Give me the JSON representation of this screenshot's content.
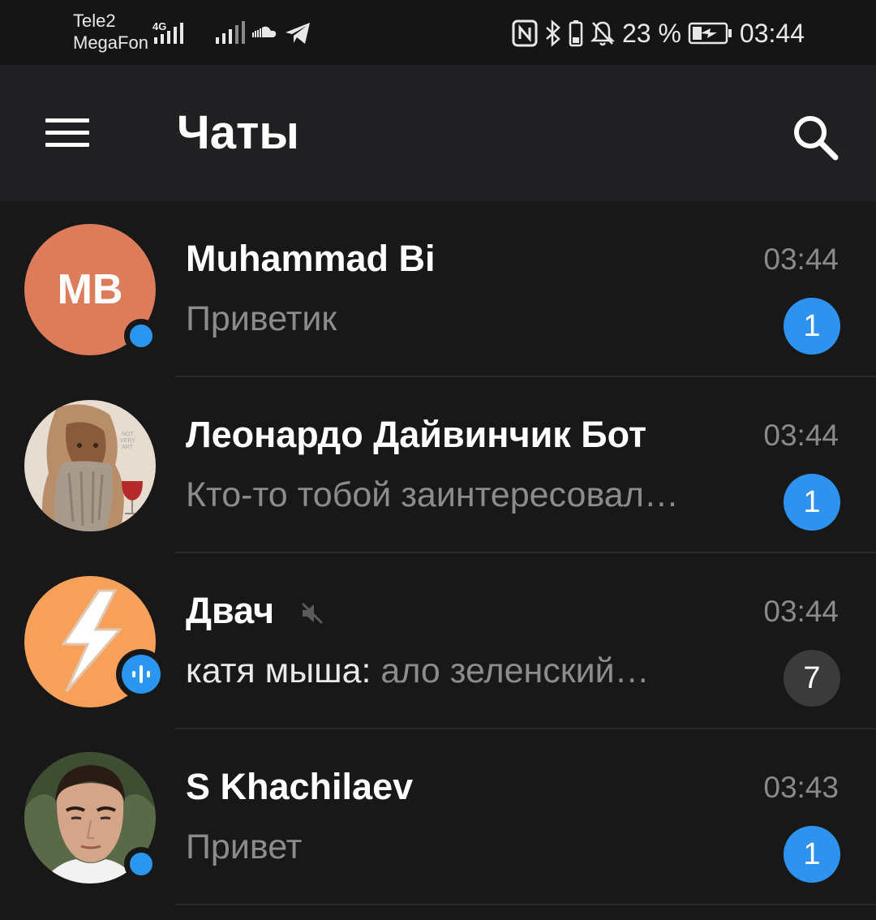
{
  "status_bar": {
    "carrier1": "Tele2",
    "carrier2": "MegaFon",
    "network": "4G",
    "battery": "23 %",
    "time": "03:44"
  },
  "header": {
    "title": "Чаты",
    "menu_icon": "hamburger-menu-icon",
    "search_icon": "search-icon"
  },
  "chats": [
    {
      "name": "Muhammad Bi",
      "initials": "MB",
      "avatar_color": "#dc7c5a",
      "time": "03:44",
      "sender": "",
      "message": "Приветик",
      "unread": "1",
      "online": true,
      "muted": false
    },
    {
      "name": "Леонардо Дайвинчик Бот",
      "time": "03:44",
      "sender": "",
      "message": "Кто-то тобой заинтересовал…",
      "unread": "1",
      "online": false,
      "muted": false
    },
    {
      "name": "Двач",
      "time": "03:44",
      "sender": "катя мыша:",
      "message": " ало зеленский…",
      "unread": "7",
      "online": false,
      "muted": true,
      "avatar_color": "#f7a05a"
    },
    {
      "name": "S Khachilaev",
      "time": "03:43",
      "sender": "",
      "message": "Привет",
      "unread": "1",
      "online": true,
      "muted": false
    }
  ],
  "colors": {
    "accent": "#2e93ee",
    "muted_badge": "#3b3b3b",
    "background": "#181818",
    "header": "#202022"
  }
}
